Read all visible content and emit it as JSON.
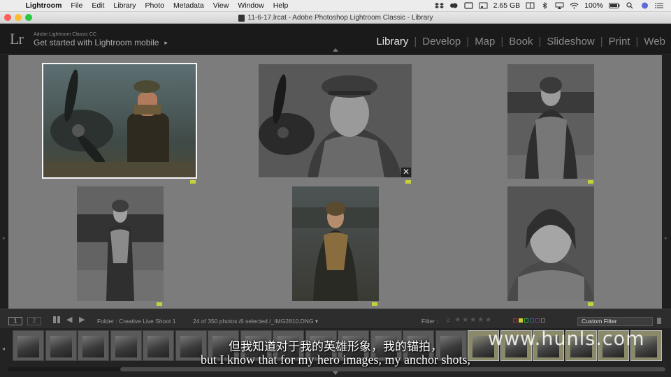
{
  "menubar": {
    "app": "Lightroom",
    "items": [
      "File",
      "Edit",
      "Library",
      "Photo",
      "Metadata",
      "View",
      "Window",
      "Help"
    ],
    "disk": "2.65 GB",
    "battery": "100%"
  },
  "window": {
    "title": "11-6-17.lrcat - Adobe Photoshop Lightroom Classic - Library"
  },
  "identity_plate": {
    "logo": "Lr",
    "product": "Adobe Lightroom Classic CC",
    "mobile_link": "Get started with Lightroom mobile",
    "mobile_arrow": "▸"
  },
  "modules": {
    "active": "Library",
    "items": [
      "Library",
      "Develop",
      "Map",
      "Book",
      "Slideshow",
      "Print",
      "Web"
    ]
  },
  "grid": {
    "close_glyph": "✕",
    "photos": [
      {
        "name": "aviator-propeller-color",
        "selected": true
      },
      {
        "name": "aviator-closeup-bw",
        "selected": false
      },
      {
        "name": "aviator-bomber-jacket-bw",
        "selected": false
      },
      {
        "name": "aviator-standing-bw",
        "selected": false
      },
      {
        "name": "aviator-helmet-color",
        "selected": false
      },
      {
        "name": "aviator-helmet-bw",
        "selected": false
      }
    ]
  },
  "toolbar": {
    "screen1": "1",
    "screen2": "2",
    "folder": "Folder : Creative Live Shoot 1",
    "count": "24 of 350 photos /6 selected /_IMG2810.DNG",
    "count_arrow": "▾",
    "filter_label": "Filter :",
    "custom_filter": "Custom Filter"
  },
  "filmstrip": {
    "thumb_count": 20
  },
  "subtitles": {
    "chinese": "但我知道对于我的英雄形象，我的锚拍，",
    "english": "but I know that for my hero images, my anchor shots,"
  },
  "watermark": "www.hunls.com"
}
